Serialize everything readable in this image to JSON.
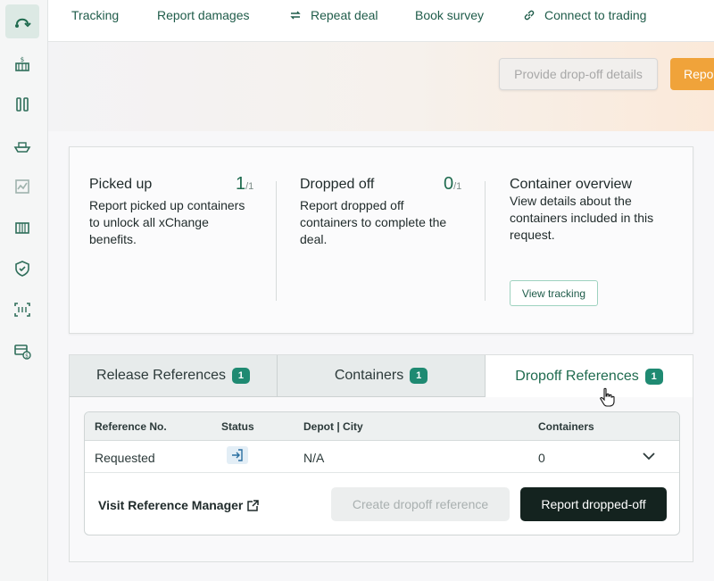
{
  "nav": {
    "items": [
      {
        "label": "Tracking"
      },
      {
        "label": "Report damages"
      },
      {
        "label": "Repeat deal",
        "icon": "repeat-icon"
      },
      {
        "label": "Book survey"
      },
      {
        "label": "Connect to trading",
        "icon": "link-icon"
      }
    ]
  },
  "actions": {
    "provide_dropoff": "Provide drop-off details",
    "report_partial": "Report"
  },
  "summary": {
    "picked_up": {
      "title": "Picked up",
      "count": "1",
      "total": "/1",
      "desc": "Report picked up containers to unlock all xChange benefits."
    },
    "dropped_off": {
      "title": "Dropped off",
      "count": "0",
      "total": "/1",
      "desc": "Report dropped off containers to complete the deal."
    },
    "overview": {
      "title": "Container overview",
      "desc": "View details about the containers included in this request.",
      "button": "View tracking"
    }
  },
  "tabs": [
    {
      "label": "Release References",
      "badge": "1"
    },
    {
      "label": "Containers",
      "badge": "1"
    },
    {
      "label": "Dropoff References",
      "badge": "1"
    }
  ],
  "table": {
    "headers": {
      "reference": "Reference No.",
      "status": "Status",
      "depot": "Depot | City",
      "containers": "Containers"
    },
    "rows": [
      {
        "reference": "Requested",
        "status_icon": "dropoff-status-icon",
        "depot": "N/A",
        "containers": "0"
      }
    ]
  },
  "footer": {
    "visit_link": "Visit Reference Manager",
    "create_button": "Create dropoff reference",
    "report_button": "Report dropped-off"
  },
  "colors": {
    "brand_green": "#1f6b4f",
    "accent_orange": "#f0a33a",
    "dark_button": "#14231f",
    "badge_teal": "#1f8a72"
  }
}
